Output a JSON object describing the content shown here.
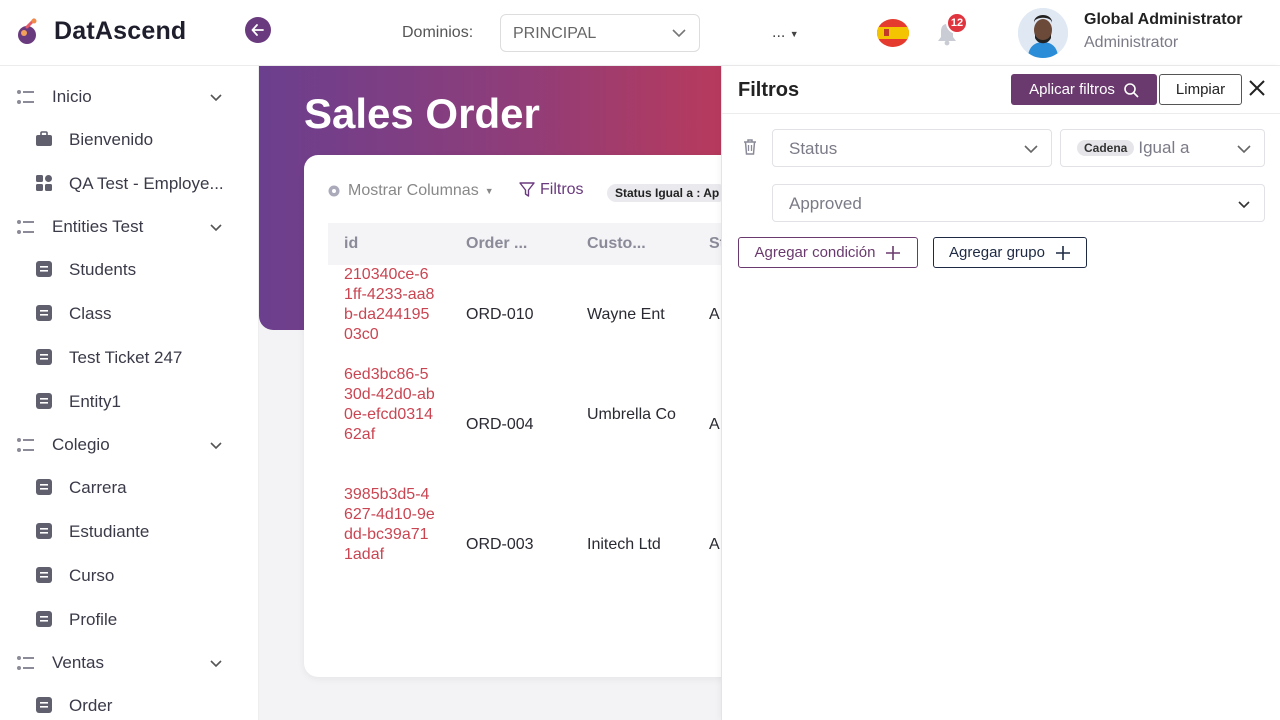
{
  "header": {
    "brand": "DatAscend",
    "domains_label": "Dominios:",
    "domain_value": "PRINCIPAL",
    "more_label": "...",
    "notifications_count": "12",
    "user_name": "Global Administrator",
    "user_role": "Administrator"
  },
  "sidebar": {
    "groups": [
      {
        "label": "Inicio",
        "items": [
          "Bienvenido",
          "QA Test - Employe..."
        ]
      },
      {
        "label": "Entities Test",
        "items": [
          "Students",
          "Class",
          "Test Ticket 247",
          "Entity1"
        ]
      },
      {
        "label": "Colegio",
        "items": [
          "Carrera",
          "Estudiante",
          "Curso",
          "Profile"
        ]
      },
      {
        "label": "Ventas",
        "items": [
          "Order"
        ]
      }
    ]
  },
  "main": {
    "title": "Sales Order",
    "show_columns": "Mostrar Columnas",
    "filters": "Filtros",
    "filter_chip": "Status Igual a : Ap",
    "columns": [
      "id",
      "Order ...",
      "Custo...",
      "St"
    ],
    "rows": [
      {
        "id": "210340ce-61ff-4233-aa8b-da24419503c0",
        "order": "ORD-010",
        "customer": "Wayne Ent",
        "status": "A"
      },
      {
        "id": "6ed3bc86-530d-42d0-ab0e-efcd031462af",
        "order": "ORD-004",
        "customer": "Umbrella Co",
        "status": "A"
      },
      {
        "id": "3985b3d5-4627-4d10-9edd-bc39a711adaf",
        "order": "ORD-003",
        "customer": "Initech Ltd",
        "status": "A"
      }
    ]
  },
  "filters_panel": {
    "title": "Filtros",
    "apply_label": "Aplicar filtros",
    "clear_label": "Limpiar",
    "field": "Status",
    "type_chip": "Cadena",
    "operator": "Igual a",
    "value": "Approved",
    "add_condition": "Agregar condición",
    "add_group": "Agregar grupo"
  },
  "colors": {
    "accent": "#6a3a6e",
    "link_red": "#c94552",
    "badge_red": "#e0343e",
    "banner_start": "#6b3f8e",
    "banner_end": "#b93a5c"
  }
}
